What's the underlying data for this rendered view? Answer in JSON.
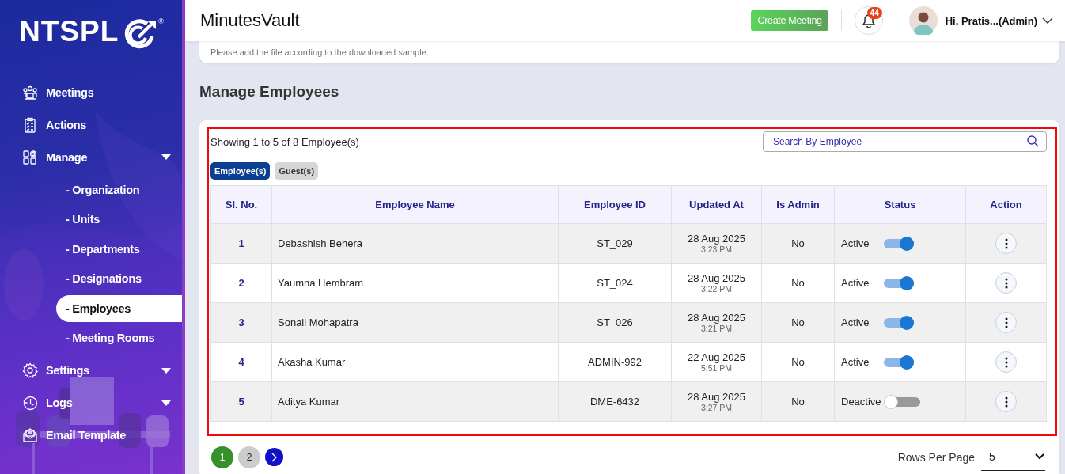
{
  "sidebar": {
    "logo": {
      "text": "NTSPL",
      "mark": "®"
    },
    "items": [
      {
        "label": "Meetings",
        "kind": "link",
        "selected": false
      },
      {
        "label": "Actions",
        "kind": "link",
        "selected": false
      },
      {
        "label": "Manage",
        "kind": "group",
        "selected": false,
        "children": [
          {
            "label": "- Organization",
            "selected": false
          },
          {
            "label": "- Units",
            "selected": false
          },
          {
            "label": "- Departments",
            "selected": false
          },
          {
            "label": "- Designations",
            "selected": false
          },
          {
            "label": "- Employees",
            "selected": true
          },
          {
            "label": "- Meeting Rooms",
            "selected": false
          }
        ]
      },
      {
        "label": "Settings",
        "kind": "group",
        "selected": false
      },
      {
        "label": "Logs",
        "kind": "group",
        "selected": false
      },
      {
        "label": "Email Template",
        "kind": "link",
        "selected": false
      }
    ]
  },
  "header": {
    "title": "MinutesVault",
    "create_button": "Create Meeting",
    "notification_count": "44",
    "user": "Hi, Pratis...(Admin)"
  },
  "notice": "Please add the file according to the downloaded sample.",
  "heading": "Manage Employees",
  "summary": "Showing 1 to 5 of 8 Employee(s)",
  "search": {
    "placeholder": "Search By Employee"
  },
  "tabs": [
    {
      "label": "Employee(s)",
      "selected": true
    },
    {
      "label": "Guest(s)",
      "selected": false
    }
  ],
  "table": {
    "columns": [
      "Sl. No.",
      "Employee Name",
      "Employee ID",
      "Updated At",
      "Is Admin",
      "Status",
      "Action"
    ],
    "rows": [
      {
        "sl": "1",
        "name": "Debashish Behera",
        "id": "ST_029",
        "date": "28 Aug 2025",
        "time": "3:23 PM",
        "admin": "No",
        "status": "Active",
        "active": true
      },
      {
        "sl": "2",
        "name": "Yaumna Hembram",
        "id": "ST_024",
        "date": "28 Aug 2025",
        "time": "3:22 PM",
        "admin": "No",
        "status": "Active",
        "active": true
      },
      {
        "sl": "3",
        "name": "Sonali Mohapatra",
        "id": "ST_026",
        "date": "28 Aug 2025",
        "time": "3:21 PM",
        "admin": "No",
        "status": "Active",
        "active": true
      },
      {
        "sl": "4",
        "name": "Akasha Kumar",
        "id": "ADMIN-992",
        "date": "22 Aug 2025",
        "time": "5:51 PM",
        "admin": "No",
        "status": "Active",
        "active": true
      },
      {
        "sl": "5",
        "name": "Aditya Kumar",
        "id": "DME-6432",
        "date": "28 Aug 2025",
        "time": "3:27 PM",
        "admin": "No",
        "status": "Deactive",
        "active": false
      }
    ]
  },
  "pagination": {
    "pages": [
      {
        "label": "1",
        "selected": true
      },
      {
        "label": "2",
        "selected": false
      }
    ]
  },
  "rows_per_page": {
    "label": "Rows Per Page",
    "value": "5"
  }
}
